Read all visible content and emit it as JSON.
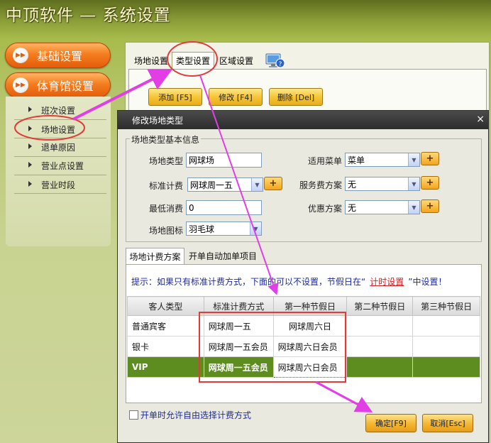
{
  "app": {
    "title": "中顶软件 — 系统设置"
  },
  "nav": {
    "groups": [
      {
        "label": "基础设置"
      },
      {
        "label": "体育馆设置"
      }
    ],
    "sub_items": [
      {
        "label": "班次设置"
      },
      {
        "label": "场地设置"
      },
      {
        "label": "退单原因"
      },
      {
        "label": "营业点设置"
      },
      {
        "label": "营业时段"
      }
    ]
  },
  "main": {
    "tabs": [
      {
        "label": "场地设置"
      },
      {
        "label": "类型设置"
      },
      {
        "label": "区域设置"
      }
    ],
    "toolbar": {
      "add": "添加 [F5]",
      "edit": "修改 [F4]",
      "delete": "删除 [Del]"
    }
  },
  "dialog": {
    "title": "修改场地类型",
    "close": "×",
    "section_title": "场地类型基本信息",
    "fields": {
      "type_label": "场地类型",
      "type_value": "网球场",
      "standard_label": "标准计费",
      "standard_value": "网球周一五",
      "minimum_label": "最低消费",
      "minimum_value": "0",
      "icon_label": "场地图标",
      "icon_value": "羽毛球",
      "menu_label": "适用菜单",
      "menu_value": "菜单",
      "service_label": "服务费方案",
      "service_value": "无",
      "discount_label": "优惠方案",
      "discount_value": "无",
      "plus": "+"
    },
    "inner_tabs": [
      {
        "label": "场地计费方案"
      },
      {
        "label": "开单自动加单项目"
      }
    ],
    "hint_before": "提示：如果只有标准计费方式，下面的可以不设置，节假日在“",
    "hint_link": "计时设置",
    "hint_after": "”中设置！",
    "table": {
      "headers": [
        "客人类型",
        "标准计费方式",
        "第一种节假日",
        "第二种节假日",
        "第三种节假日"
      ],
      "rows": [
        [
          "普通宾客",
          "网球周一五",
          "网球周六日",
          "",
          ""
        ],
        [
          "银卡",
          "网球周一五会员",
          "网球周六日会员",
          "",
          ""
        ],
        [
          "VIP",
          "网球周一五会员",
          "网球周六日会员",
          "",
          ""
        ]
      ]
    },
    "checkbox_label": "开单时允许自由选择计费方式",
    "ok": "确定[F9]",
    "cancel": "取消[Esc]"
  },
  "colors": {
    "accent_orange": "#f47d1f",
    "annotation_magenta": "#e23ee6",
    "annotation_red": "#e33a3a",
    "selected_row": "#5e8d1f"
  }
}
